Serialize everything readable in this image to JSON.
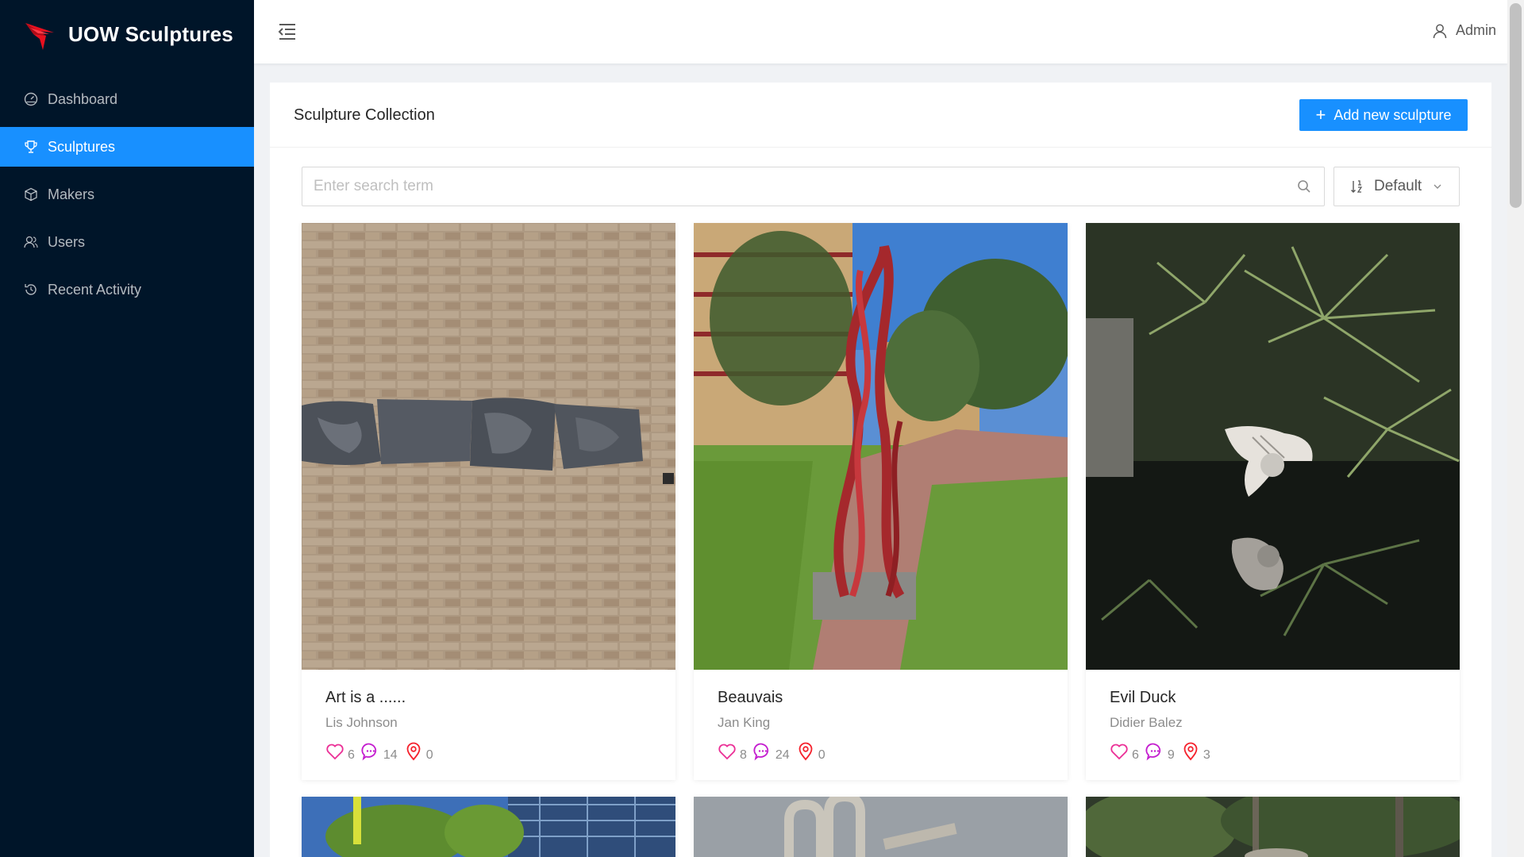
{
  "app": {
    "title": "UOW Sculptures"
  },
  "sidebar": {
    "items": [
      {
        "label": "Dashboard",
        "icon": "dashboard-icon",
        "active": false
      },
      {
        "label": "Sculptures",
        "icon": "trophy-icon",
        "active": true
      },
      {
        "label": "Makers",
        "icon": "cube-icon",
        "active": false
      },
      {
        "label": "Users",
        "icon": "users-icon",
        "active": false
      },
      {
        "label": "Recent Activity",
        "icon": "history-icon",
        "active": false
      }
    ]
  },
  "header": {
    "user_label": "Admin",
    "fold_icon": "menu-fold-icon"
  },
  "panel": {
    "title": "Sculpture Collection",
    "add_button_label": "Add new sculpture",
    "search": {
      "placeholder": "Enter search term",
      "value": ""
    },
    "sort": {
      "value": "Default"
    }
  },
  "sculptures": [
    {
      "title": "Art is a ......",
      "maker": "Lis Johnson",
      "likes": "6",
      "comments": "14",
      "visits": "0"
    },
    {
      "title": "Beauvais",
      "maker": "Jan King",
      "likes": "8",
      "comments": "24",
      "visits": "0"
    },
    {
      "title": "Evil Duck",
      "maker": "Didier Balez",
      "likes": "6",
      "comments": "9",
      "visits": "3"
    }
  ],
  "colors": {
    "sidebar_bg": "#001529",
    "accent": "#1890ff",
    "stat_icon": "#eb2f96",
    "logo_red": "#e8101f"
  }
}
